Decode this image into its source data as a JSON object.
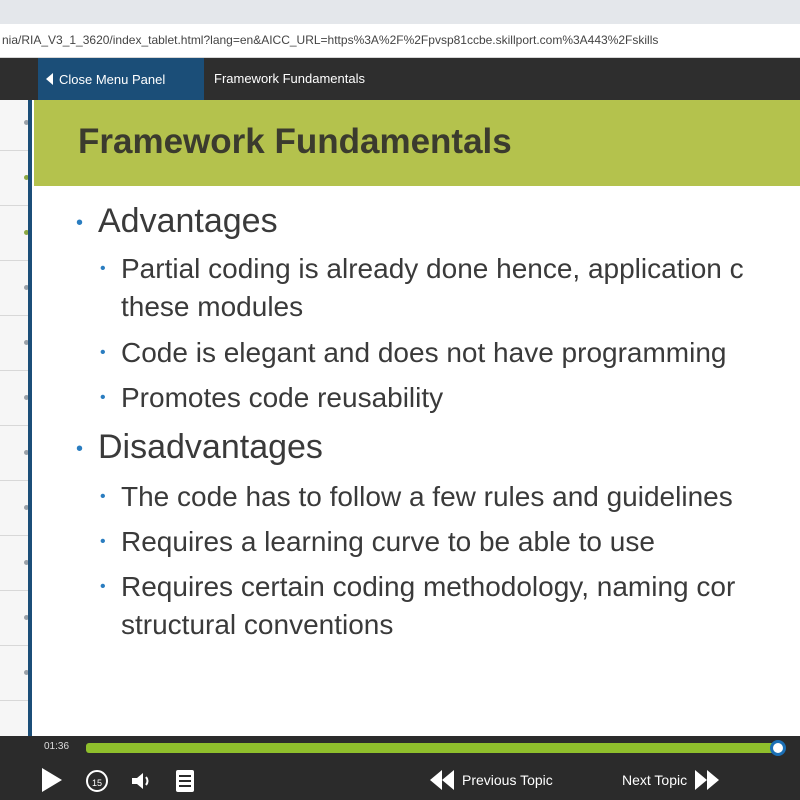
{
  "browser": {
    "url": "nia/RIA_V3_1_3620/index_tablet.html?lang=en&AICC_URL=https%3A%2F%2Fpvsp81ccbe.skillport.com%3A443%2Fskills"
  },
  "header": {
    "close_menu_label": "Close Menu Panel",
    "title": "Framework Fundamentals"
  },
  "slide": {
    "title": "Framework Fundamentals",
    "sections": [
      {
        "heading": "Advantages",
        "items": [
          "Partial coding is already done hence, application c",
          "these modules",
          "Code is elegant and does not have programming",
          "Promotes code reusability"
        ]
      },
      {
        "heading": "Disadvantages",
        "items": [
          "The code has to follow a few rules and guidelines",
          "Requires a learning curve to be able to use",
          "Requires certain coding methodology, naming cor",
          "structural conventions"
        ]
      }
    ]
  },
  "player": {
    "elapsed_time": "01:36",
    "progress": 0.99,
    "previous_topic_label": "Previous Topic",
    "next_topic_label": "Next Topic",
    "replay_label": "15"
  },
  "colors": {
    "title_band": "#b4c24d",
    "header_bg": "#2e2e2e",
    "close_button_bg": "#1b4e78",
    "progress_fill": "#8fbf2c",
    "bullet": "#2a7dc0"
  }
}
